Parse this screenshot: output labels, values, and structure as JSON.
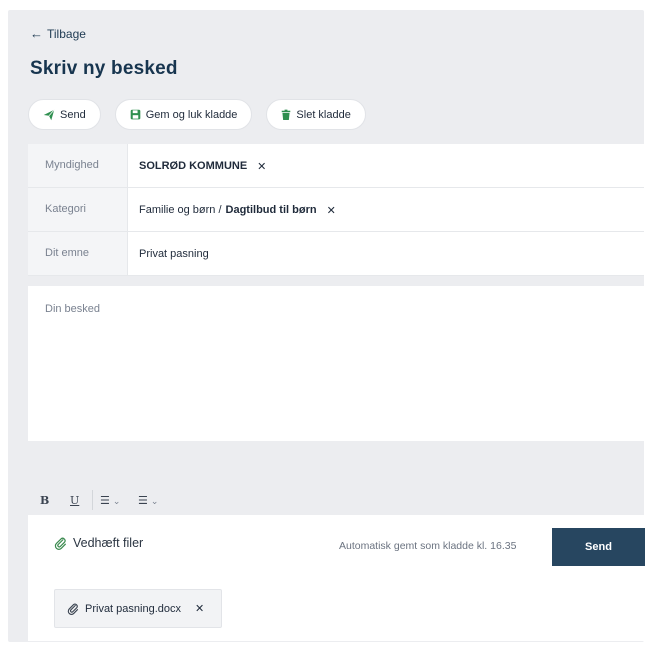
{
  "nav": {
    "back_arrow": "←",
    "back_label": "Tilbage"
  },
  "page": {
    "title": "Skriv ny besked"
  },
  "toolbar": {
    "send": {
      "icon": "paper-plane-icon",
      "label": "Send"
    },
    "save_close": {
      "icon": "floppy-disk-icon",
      "label": "Gem og luk kladde"
    },
    "delete_draft": {
      "icon": "trash-icon",
      "label": "Slet kladde"
    }
  },
  "form": {
    "authority": {
      "label": "Myndighed",
      "value": "SOLRØD KOMMUNE",
      "remove": "✕"
    },
    "category": {
      "label": "Kategori",
      "parent": "Familie og børn /",
      "value": "Dagtilbud til børn",
      "remove": "✕"
    },
    "subject": {
      "label": "Dit emne",
      "value": "Privat pasning"
    },
    "message": {
      "placeholder": "Din besked",
      "value": ""
    }
  },
  "editor": {
    "bold": "B",
    "underline": "U",
    "bullet_list": "☰",
    "numbered_list": "☰",
    "chevron": "⌄"
  },
  "footer": {
    "attach_label": "Vedhæft filer",
    "autosave_text": "Automatisk gemt som kladde kl. 16.35",
    "send_label": "Send"
  },
  "attachments": [
    {
      "filename": "Privat pasning.docx",
      "remove": "✕"
    }
  ],
  "colors": {
    "primary": "#274660",
    "accent_green": "#2f8f4f",
    "background": "#ecedf0"
  }
}
